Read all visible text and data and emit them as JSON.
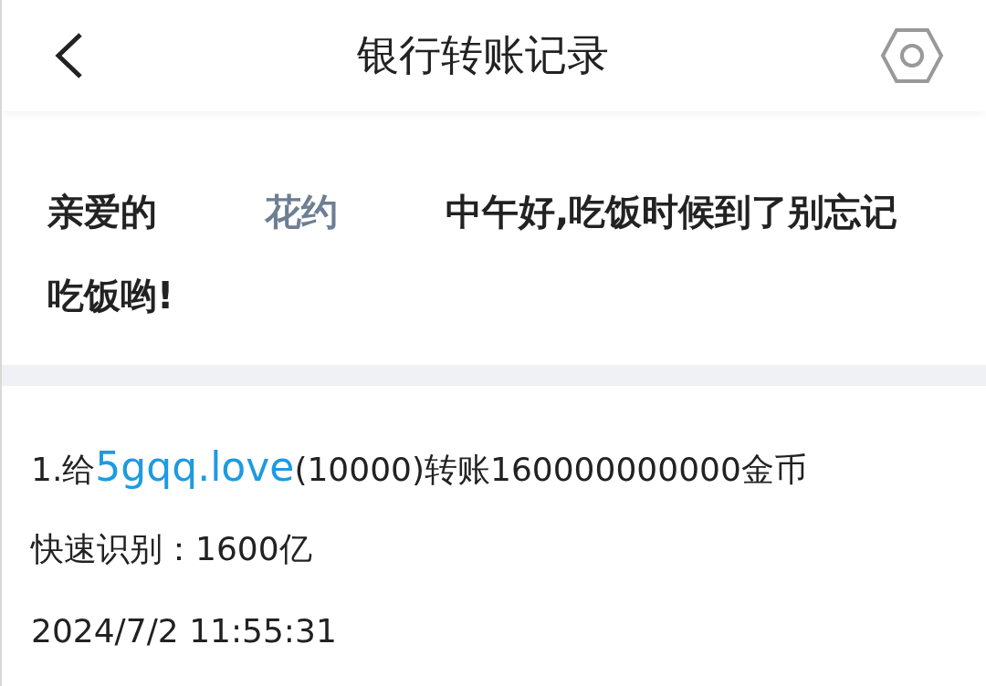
{
  "header": {
    "title": "银行转账记录"
  },
  "greeting": {
    "prefix": "亲爱的",
    "name": "花约",
    "message": "中午好,吃饭时候到了别忘记吃饭哟!"
  },
  "record": {
    "prefix": "1.给",
    "link": "5gqq.love",
    "suffix": "(10000)转账160000000000金币",
    "quick": "快速识别：1600亿",
    "time": "2024/7/2 11:55:31"
  }
}
